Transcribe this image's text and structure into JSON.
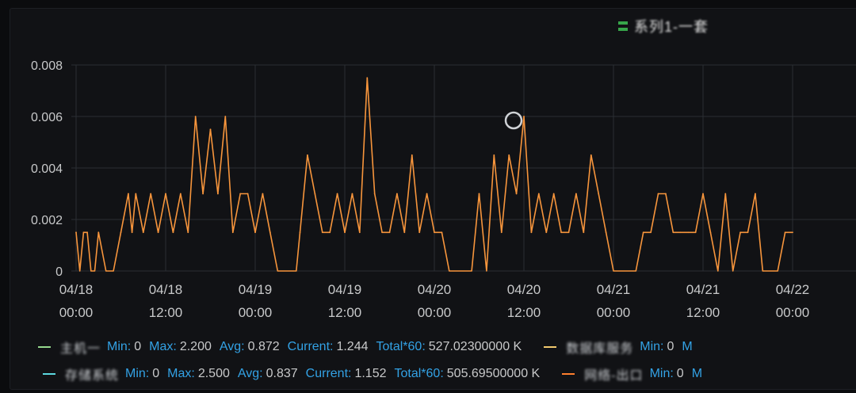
{
  "legend_top": {
    "color": "#37a64a",
    "label": "系列1-一套"
  },
  "chart_data": {
    "type": "line",
    "y_ticks": [
      "0.008",
      "0.006",
      "0.004",
      "0.002",
      "0"
    ],
    "ylim": [
      0,
      0.008
    ],
    "x_ticks": [
      {
        "date": "04/18",
        "time": "00:00"
      },
      {
        "date": "04/18",
        "time": "12:00"
      },
      {
        "date": "04/19",
        "time": "00:00"
      },
      {
        "date": "04/19",
        "time": "12:00"
      },
      {
        "date": "04/20",
        "time": "00:00"
      },
      {
        "date": "04/20",
        "time": "12:00"
      },
      {
        "date": "04/21",
        "time": "00:00"
      },
      {
        "date": "04/21",
        "time": "12:00"
      },
      {
        "date": "04/22",
        "time": "00:00"
      }
    ],
    "grid": true,
    "series": [
      {
        "color": "#f7953c",
        "x_hours": [
          0,
          0.5,
          1,
          1.5,
          2,
          2.5,
          3,
          4,
          4.5,
          5,
          6,
          7,
          7.5,
          8,
          9,
          10,
          11,
          12,
          13,
          14,
          15,
          16,
          17,
          18,
          19,
          20,
          21,
          22,
          23,
          24,
          25,
          26,
          27,
          28,
          29,
          29.5,
          30,
          31,
          32,
          33,
          34,
          35,
          36,
          37,
          38,
          39,
          40,
          41,
          42,
          43,
          44,
          45,
          46,
          47,
          48,
          49,
          50,
          51,
          52,
          53,
          54,
          55,
          56,
          57,
          58,
          59,
          60,
          61,
          62,
          63,
          64,
          65,
          66,
          67,
          68,
          69,
          70,
          71,
          72,
          73,
          74,
          75,
          76,
          77,
          78,
          79,
          80,
          81,
          82,
          83,
          84,
          85,
          86,
          87,
          88,
          89,
          90,
          91,
          92,
          93,
          94,
          95,
          96
        ],
        "values": [
          0.0015,
          0,
          0.0015,
          0.0015,
          0,
          0,
          0.0015,
          0,
          0,
          0,
          0.0015,
          0.003,
          0.0015,
          0.003,
          0.0015,
          0.003,
          0.0015,
          0.003,
          0.0015,
          0.003,
          0.0015,
          0.006,
          0.003,
          0.0055,
          0.003,
          0.006,
          0.0015,
          0.003,
          0.003,
          0.0015,
          0.003,
          0.0015,
          0,
          0,
          0,
          0,
          0.0015,
          0.0045,
          0.003,
          0.0015,
          0.0015,
          0.003,
          0.0015,
          0.003,
          0.0015,
          0.0075,
          0.003,
          0.0015,
          0.0015,
          0.003,
          0.0015,
          0.0045,
          0.0015,
          0.003,
          0.0015,
          0.0015,
          0,
          0,
          0,
          0,
          0.003,
          0,
          0.0045,
          0.0015,
          0.0045,
          0.003,
          0.006,
          0.0015,
          0.003,
          0.0015,
          0.003,
          0.0015,
          0.0015,
          0.003,
          0.0015,
          0.0045,
          0.003,
          0.0015,
          0,
          0,
          0,
          0,
          0.0015,
          0.0015,
          0.003,
          0.003,
          0.0015,
          0.0015,
          0.0015,
          0.0015,
          0.003,
          0.0015,
          0,
          0.003,
          0,
          0.0015,
          0.0015,
          0.003,
          0,
          0,
          0,
          0.0015,
          0.0015
        ]
      }
    ]
  },
  "legend_rows": [
    [
      {
        "color": "#96d98d",
        "name": "主机一",
        "min": "0",
        "max": "2.200",
        "avg": "0.872",
        "current": "1.244",
        "total": "527.02300000 K"
      },
      {
        "color": "#f2c96d",
        "name": "数据库服务",
        "min": "0",
        "max_prefix": "M"
      }
    ],
    [
      {
        "color": "#5cd8e0",
        "name": "存储系统",
        "min": "0",
        "max": "2.500",
        "avg": "0.837",
        "current": "1.152",
        "total": "505.69500000 K"
      },
      {
        "color": "#ff7f2e",
        "name": "网络-出口",
        "min": "0",
        "max_prefix": "M"
      }
    ]
  ],
  "labels": {
    "min": "Min:",
    "max": "Max:",
    "avg": "Avg:",
    "current": "Current:",
    "total": "Total*60:"
  }
}
